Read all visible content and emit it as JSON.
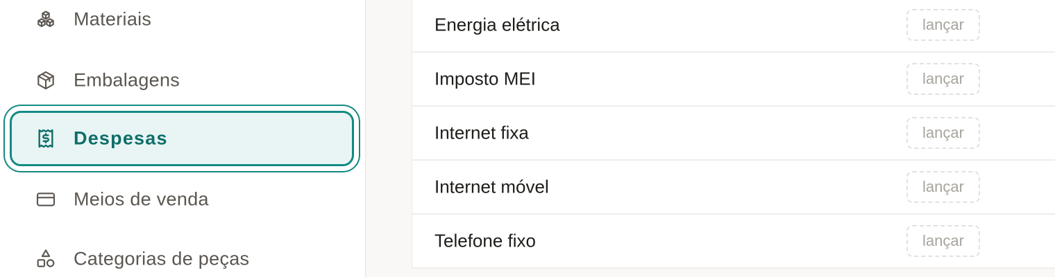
{
  "sidebar": {
    "items": [
      {
        "label": "Materiais",
        "icon": "boxes-icon",
        "active": false
      },
      {
        "label": "Embalagens",
        "icon": "package-icon",
        "active": false
      },
      {
        "label": "Despesas",
        "icon": "receipt-icon",
        "active": true
      },
      {
        "label": "Meios de venda",
        "icon": "credit-card-icon",
        "active": false
      },
      {
        "label": "Categorias de peças",
        "icon": "shapes-icon",
        "active": false
      }
    ]
  },
  "main": {
    "expenses": [
      {
        "name": "Energia elétrica",
        "action_label": "lançar"
      },
      {
        "name": "Imposto MEI",
        "action_label": "lançar"
      },
      {
        "name": "Internet fixa",
        "action_label": "lançar"
      },
      {
        "name": "Internet móvel",
        "action_label": "lançar"
      },
      {
        "name": "Telefone fixo",
        "action_label": "lançar"
      }
    ]
  },
  "colors": {
    "accent": "#138a83",
    "active_bg": "#e8f5f4",
    "active_text": "#0f6e6a",
    "nav_text": "#5b5650",
    "row_text": "#1f1d1a",
    "action_text": "#a8a49d"
  }
}
